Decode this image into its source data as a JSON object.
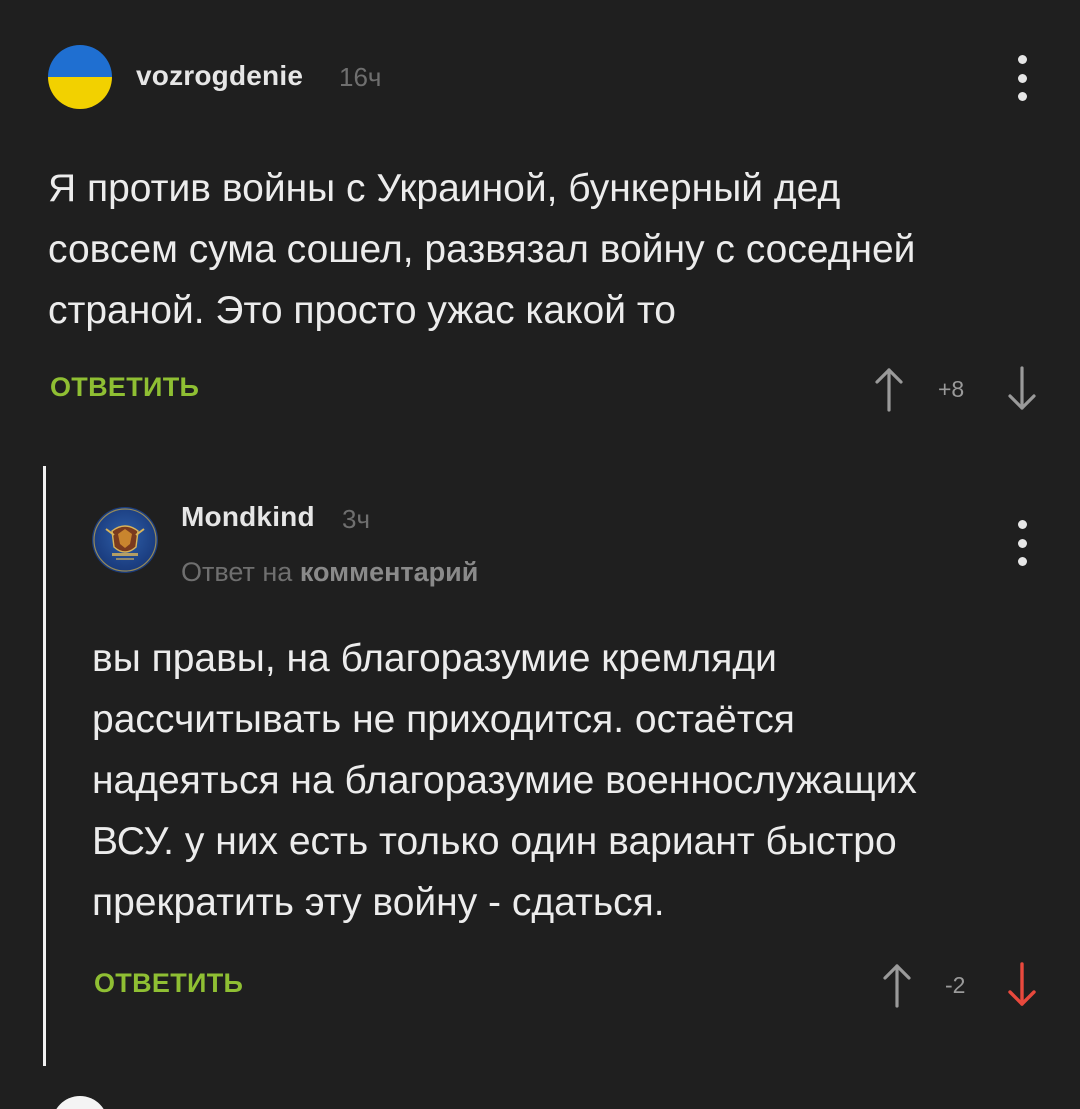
{
  "comments": [
    {
      "username": "vozrogdenie",
      "time": "16ч",
      "text": "Я против войны с Украиной, бункерный дед\nсовсем сума сошел, развязал войну с соседней\nстраной. Это просто ужас какой то",
      "reply_label": "ОТВЕТИТЬ",
      "score": "+8",
      "avatar": "ukraine-flag-avatar"
    },
    {
      "username": "Mondkind",
      "time": "3ч",
      "reply_to_prefix": "Ответ на",
      "reply_to_link": "комментарий",
      "text": "вы правы, на благоразумие кремляди\nрассчитывать не приходится. остаётся\nнадеяться на благоразумие военнослужащих\nВСУ. у них есть только один вариант быстро\nпрекратить эту войну - сдаться.",
      "reply_label": "ОТВЕТИТЬ",
      "score": "-2",
      "downvoted": true
    }
  ],
  "colors": {
    "background": "#1f1f1f",
    "reply_green": "#8fbf33",
    "downvote_red": "#e8493d",
    "flag_blue": "#1f6fd1",
    "flag_yellow": "#f2d100"
  }
}
